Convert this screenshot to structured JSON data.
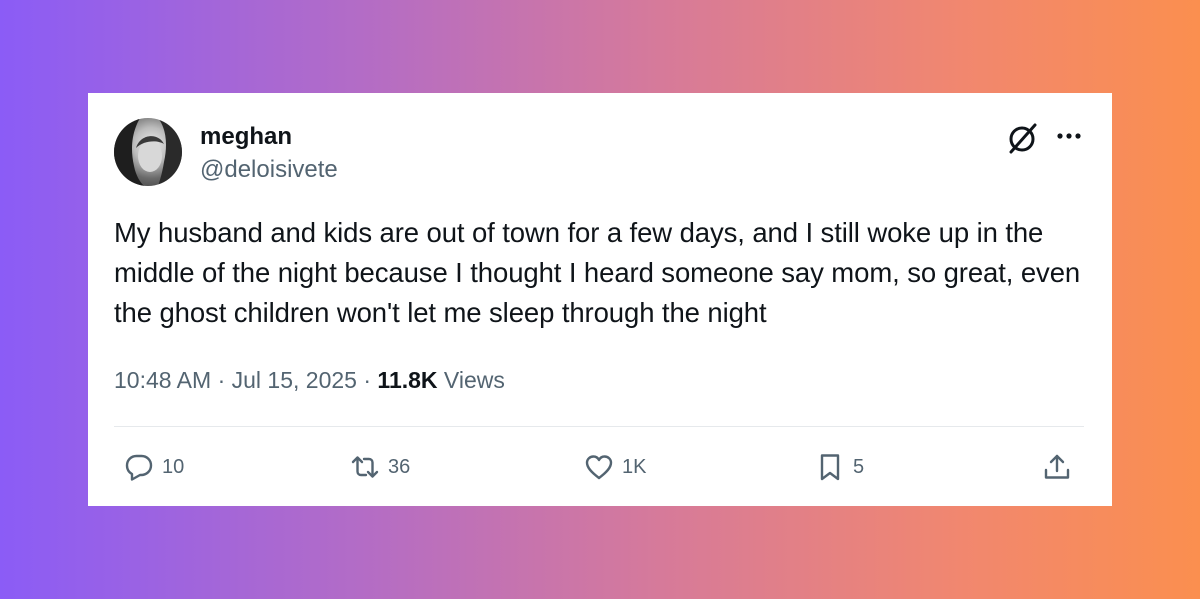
{
  "author": {
    "display_name": "meghan",
    "handle": "@deloisivete"
  },
  "tweet": {
    "text": "My husband and kids are out of town for a few days, and I still woke up in the middle of the night because I thought I heard someone say mom, so great, even the ghost children won't let me sleep through the night"
  },
  "meta": {
    "time": "10:48 AM",
    "separator": "·",
    "date": "Jul 15, 2025",
    "views_count": "11.8K",
    "views_label": "Views"
  },
  "actions": {
    "reply_count": "10",
    "retweet_count": "36",
    "like_count": "1K",
    "bookmark_count": "5"
  },
  "icons": {
    "header_right": [
      "grok-icon",
      "more-icon"
    ],
    "actions": [
      "reply-icon",
      "retweet-icon",
      "like-icon",
      "bookmark-icon",
      "share-icon"
    ]
  },
  "colors": {
    "gradient_start": "#8b5cf6",
    "gradient_end": "#fb8f4f",
    "text_primary": "#0f1419",
    "text_secondary": "#536471"
  }
}
